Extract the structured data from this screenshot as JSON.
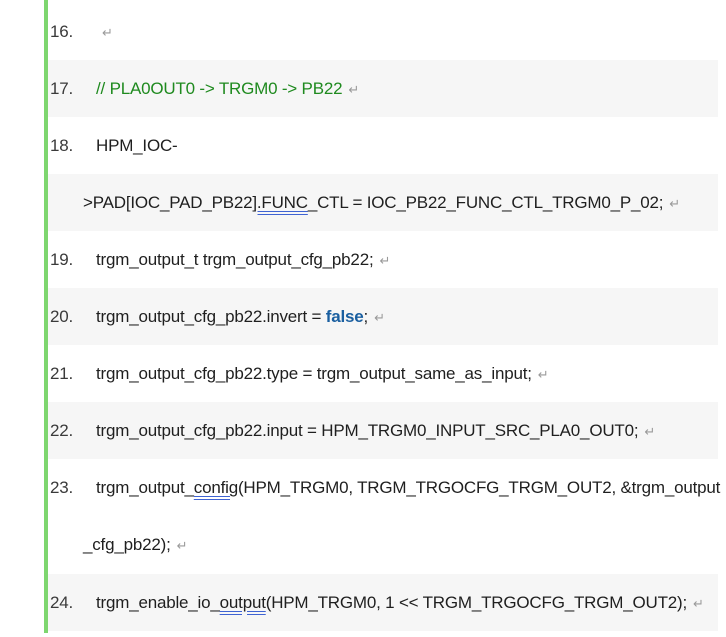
{
  "lines": [
    {
      "num": "16.",
      "parts": []
    },
    {
      "num": "17.",
      "parts": [
        {
          "t": "// PLA0OUT0 -> TRGM0 -> PB22",
          "c": "cmt"
        }
      ]
    },
    {
      "num": "18.",
      "parts": [
        {
          "t": "HPM_IOC-",
          "c": ""
        }
      ]
    },
    {
      "num": "",
      "parts": [
        {
          "t": ">PAD[IOC_PAD_PB22",
          "c": ""
        },
        {
          "t": "].FUNC",
          "c": "ul"
        },
        {
          "t": "_CTL = IOC_PB22_FUNC_CTL_TRGM0_P_02;",
          "c": ""
        }
      ]
    },
    {
      "num": "19.",
      "parts": [
        {
          "t": "trgm_output_t trgm_output_cfg_pb22;",
          "c": ""
        }
      ]
    },
    {
      "num": "20.",
      "parts": [
        {
          "t": "trgm_output_cfg_pb22.invert = ",
          "c": ""
        },
        {
          "t": "false",
          "c": "kw"
        },
        {
          "t": ";",
          "c": ""
        }
      ]
    },
    {
      "num": "21.",
      "parts": [
        {
          "t": "trgm_output_cfg_pb22.type = trgm_output_same_as_input;",
          "c": ""
        }
      ]
    },
    {
      "num": "22.",
      "parts": [
        {
          "t": "trgm_output_cfg_pb22.input = HPM_TRGM0_INPUT_SRC_PLA0_OUT0;",
          "c": ""
        }
      ]
    },
    {
      "num": "23.",
      "parts": [
        {
          "t": "trgm_output_",
          "c": ""
        },
        {
          "t": "config",
          "c": "ul"
        },
        {
          "t": "(HPM_TRGM0, TRGM_TRGOCFG_TRGM_OUT2, &trgm_output",
          "c": ""
        }
      ]
    },
    {
      "num": "",
      "parts": [
        {
          "t": "_cfg_pb22);",
          "c": ""
        }
      ]
    },
    {
      "num": "24.",
      "parts": [
        {
          "t": "trgm_enable_io_",
          "c": ""
        },
        {
          "t": "output",
          "c": "ul"
        },
        {
          "t": "(HPM_TRGM0, 1 << TRGM_TRGOCFG_TRGM_OUT2);",
          "c": ""
        }
      ]
    }
  ],
  "return_mark": "↵",
  "accent_color": "#7ed66f"
}
